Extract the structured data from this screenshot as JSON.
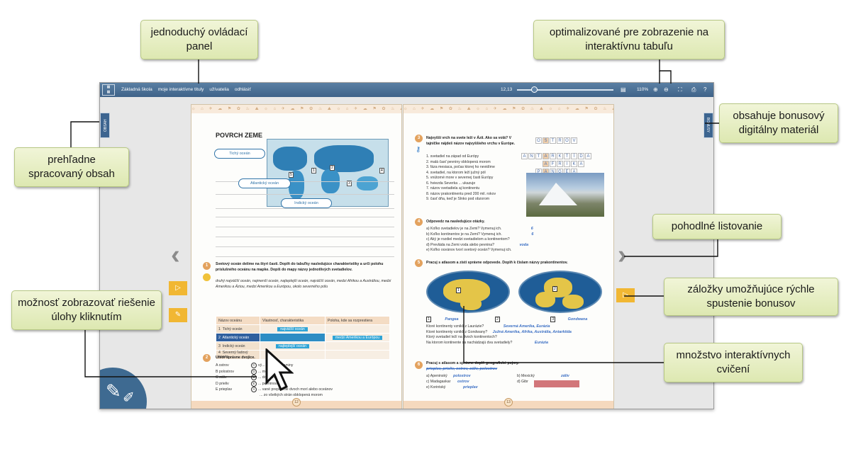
{
  "callouts": {
    "control_panel": "jednoduchý ovládací panel",
    "whiteboard": "optimalizované pre zobrazenie na interaktívnu tabuľu",
    "bonus": "obsahuje bonusový digitálny materiál",
    "content": "prehľadne spracovaný obsah",
    "flipping": "pohodlné listovanie",
    "solutions": "možnosť zobrazovať riešenie úlohy kliknutím",
    "bookmarks": "záložky umožňujúce rýchle spustenie bonusov",
    "exercises": "množstvo interaktívnych cvičení"
  },
  "toolbar": {
    "nav": [
      "Základná škola",
      "moje interaktívne tituly",
      "užívatelia",
      "odhlásiť"
    ],
    "page": "12,13",
    "zoom": "110%",
    "slider_fraction": 0.18
  },
  "side_tabs": {
    "left": "OBSAH",
    "right": "BONUSY"
  },
  "left_page": {
    "title": "POVRCH ZEME",
    "ovals": [
      "Tichý oceán",
      "Atlantický oceán",
      "Indický oceán"
    ],
    "map_numbers": [
      "5",
      "1",
      "2",
      "3",
      "4"
    ],
    "task1_num": "1",
    "task1_text": "Svetový oceán delíme na štyri časti. Doplň do tabuľky nasledujúce charakteristiky a urči polohu príslušného oceánu na mapke. Dopíš do mapy názvy jednotlivých svetadielov.",
    "task1_words": "druhý najväčší oceán, najmenší oceán, najteplejší oceán, najväčší oceán, medzi Afrikou a Austráliou, medzi Amerikou a Áziou, medzi Amerikou a Európou, okolo severného pólu",
    "table_headers": [
      "Názov oceánu",
      "Vlastnosť, charakteristika",
      "Poloha, kde sa rozprestiera"
    ],
    "table_rows": [
      {
        "num": "1",
        "name": "Tichý oceán",
        "prop": "najväčší oceán",
        "pos": ""
      },
      {
        "num": "2",
        "name": "Atlantický oceán",
        "prop": "",
        "pos": "medzi Amerikou a Európou"
      },
      {
        "num": "3",
        "name": "Indický oceán",
        "prop": "najteplejší oceán",
        "pos": ""
      },
      {
        "num": "4",
        "name": "Severný ľadový oceán",
        "prop": "",
        "pos": ""
      }
    ],
    "task2_num": "2",
    "task2_title": "Utvor správne dvojice.",
    "pairs": [
      {
        "left": "A  ostrov",
        "letter": "C",
        "right": "vý... more do pevniny"
      },
      {
        "left": "B  polostrov",
        "letter": "D",
        "right": "... medzi pevninami"
      },
      {
        "left": "C  záliv",
        "letter": "B",
        "right": "... do mora"
      },
      {
        "left": "D  prieliv",
        "letter": "E",
        "right": "... pevninou"
      },
      {
        "left": "E  prieplav",
        "letter": "A",
        "right": "... vané prepojenie dvoch morí alebo oceánov"
      }
    ],
    "pair_last": "... zo všetkých strán obklopená morom",
    "page_number": "12"
  },
  "right_page": {
    "task3_num": "3",
    "task3_text": "Najvyšší vrch na svete leží v Ázii. Ako sa volá? V tajničke nájdeš názov najvyššieho vrchu v Európe.",
    "task3_list": [
      "1. svetadiel na západ od Európy",
      "2. malá časť pevniny obklopená morom",
      "3. fáza mesiaca, počas ktorej ho nevidíme",
      "4. svetadiel, na ktorom leží južný pól",
      "5. vnútorné more v severnej časti Európy",
      "6. hviezda Severka ... ukazuje",
      "7. názov svetadiela aj kontinentu",
      "8. názov prakontinentu pred 200 mil. rokov",
      "9. časť dňa, keď je Slnko pod obzorom"
    ],
    "crossword": [
      "OSTROV",
      "ANTARKTÍDA",
      "AFRIKA",
      "PANGEA",
      "NOC"
    ],
    "task4_num": "4",
    "task4_title": "Odpovedz na nasledujúce otázky.",
    "task4_q": [
      {
        "q": "a) Koľko svetadielov je na Zemi? Vymenuj ich.",
        "a": "6"
      },
      {
        "q": "b) Koľko kontinentov je na Zemi? Vymenuj ich.",
        "a": "6"
      },
      {
        "q": "c) Aký je rozdiel medzi svetadielom a kontinentom?",
        "a": ""
      },
      {
        "q": "d) Prevláda na Zemi voda alebo pevnina?",
        "a": "voda"
      },
      {
        "q": "e) Koľko oceánov tvorí svetový oceán? Vymenuj ich.",
        "a": ""
      }
    ],
    "task5_num": "5",
    "task5_title": "Pracuj s atlasom a zisti správne odpovede. Doplň k číslam názvy prakontinentov.",
    "globe_labels": [
      "Pangea",
      "Gondwana"
    ],
    "globe_nums": [
      "1",
      "2",
      "3"
    ],
    "task5_q": [
      {
        "q": "Ktoré kontinenty vznikli z Laurázie?",
        "a": "Severná Amerika, Eurázia"
      },
      {
        "q": "Ktoré kontinenty vznikli z Gondwany?",
        "a": "Južná Amerika, Afrika, Austrália, Antarktída"
      },
      {
        "q": "Ktorý svetadiel leží na dvoch kontinentoch?",
        "a": ""
      },
      {
        "q": "Na ktorom kontinente sa nachádzajú dva svetadiely?",
        "a": "Eurázia"
      }
    ],
    "task6_num": "6",
    "task6_title": "Pracuj s atlasom a správne doplň geografické pojmy.",
    "task6_words": "prieplav, prieliv, ostrov, záliv, polostrov",
    "task6_q": [
      {
        "q": "a) Apeninský",
        "a": "polostrov"
      },
      {
        "q": "b) Mexický",
        "a": "záliv"
      },
      {
        "q": "c) Madagaskar",
        "a": "ostrov"
      },
      {
        "q": "d) Gibr",
        "a": ""
      },
      {
        "q": "e) Korintský",
        "a": "prieplav"
      }
    ],
    "page_number": "13"
  },
  "colors": {
    "toolbar": "#4a6f96",
    "callout": "#e6eec4",
    "accent": "#e3a25e",
    "bookmark": "#f1b733"
  }
}
